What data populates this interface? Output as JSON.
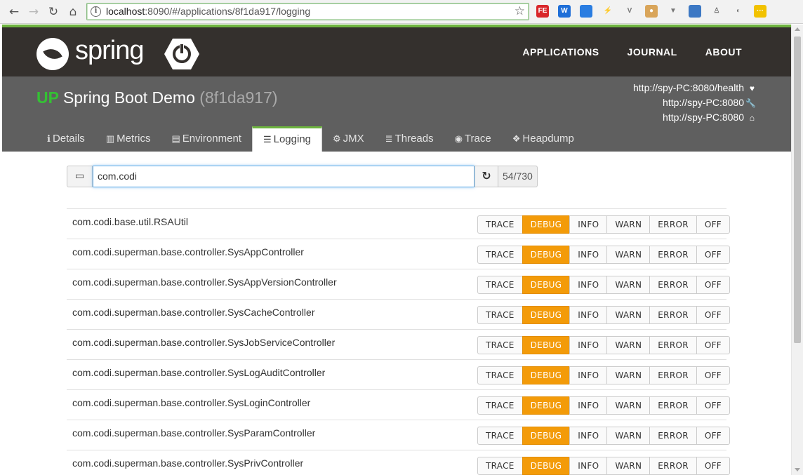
{
  "browser": {
    "url": "localhost:8090/#/applications/8f1da917/logging",
    "url_host": "localhost",
    "url_rest": ":8090/#/applications/8f1da917/logging",
    "extensions": [
      {
        "name": "fe-extension-icon",
        "label": "FE",
        "color": "#d9262a"
      },
      {
        "name": "w-extension-icon",
        "label": "W",
        "color": "#1f6fd8"
      },
      {
        "name": "blue-square-extension-icon",
        "label": "",
        "color": "#2a7de1"
      },
      {
        "name": "lightning-extension-icon",
        "label": "⚡",
        "color": "#ffffff"
      },
      {
        "name": "v-extension-icon",
        "label": "V",
        "color": "#ffffff"
      },
      {
        "name": "cookie-extension-icon",
        "label": "●",
        "color": "#d9a55a"
      },
      {
        "name": "vue-extension-icon",
        "label": "▼",
        "color": "#ffffff"
      },
      {
        "name": "window-extension-icon",
        "label": "",
        "color": "#3c78c4"
      },
      {
        "name": "puzzle-extension-icon",
        "label": "♙",
        "color": "#ffffff"
      },
      {
        "name": "circle-extension-icon",
        "label": "◐",
        "color": "#ffffff"
      },
      {
        "name": "menu-extension-icon",
        "label": "···",
        "color": "#f2c200"
      }
    ]
  },
  "topbar": {
    "logo_text": "spring",
    "nav": [
      "APPLICATIONS",
      "JOURNAL",
      "ABOUT"
    ]
  },
  "app": {
    "status": "UP",
    "name": "Spring Boot Demo",
    "id": "(8f1da917)",
    "links": [
      {
        "text": "http://spy-PC:8080/health",
        "icon": "heartbeat-icon",
        "glyph": "♥"
      },
      {
        "text": "http://spy-PC:8080",
        "icon": "wrench-icon",
        "glyph": "🔧"
      },
      {
        "text": "http://spy-PC:8080",
        "icon": "home-icon",
        "glyph": "⌂"
      }
    ],
    "tabs": [
      {
        "label": "Details",
        "icon": "info-icon",
        "glyph": "ℹ"
      },
      {
        "label": "Metrics",
        "icon": "bar-chart-icon",
        "glyph": "▥"
      },
      {
        "label": "Environment",
        "icon": "server-icon",
        "glyph": "▤"
      },
      {
        "label": "Logging",
        "icon": "sliders-icon",
        "glyph": "☰"
      },
      {
        "label": "JMX",
        "icon": "cogs-icon",
        "glyph": "⚙"
      },
      {
        "label": "Threads",
        "icon": "list-icon",
        "glyph": "≣"
      },
      {
        "label": "Trace",
        "icon": "eye-icon",
        "glyph": "◉"
      },
      {
        "label": "Heapdump",
        "icon": "cubes-icon",
        "glyph": "❖"
      }
    ],
    "active_tab": "Logging"
  },
  "filter": {
    "value": "com.codi",
    "count": "54/730"
  },
  "levels": [
    "TRACE",
    "DEBUG",
    "INFO",
    "WARN",
    "ERROR",
    "OFF"
  ],
  "loggers": [
    {
      "name": "com.codi.base.util.RSAUtil",
      "level": "DEBUG"
    },
    {
      "name": "com.codi.superman.base.controller.SysAppController",
      "level": "DEBUG"
    },
    {
      "name": "com.codi.superman.base.controller.SysAppVersionController",
      "level": "DEBUG"
    },
    {
      "name": "com.codi.superman.base.controller.SysCacheController",
      "level": "DEBUG"
    },
    {
      "name": "com.codi.superman.base.controller.SysJobServiceController",
      "level": "DEBUG"
    },
    {
      "name": "com.codi.superman.base.controller.SysLogAuditController",
      "level": "DEBUG"
    },
    {
      "name": "com.codi.superman.base.controller.SysLoginController",
      "level": "DEBUG"
    },
    {
      "name": "com.codi.superman.base.controller.SysParamController",
      "level": "DEBUG"
    },
    {
      "name": "com.codi.superman.base.controller.SysPrivController",
      "level": "DEBUG"
    }
  ],
  "colors": {
    "spring_green": "#6db33f",
    "status_up": "#34c134",
    "active_level": "#f39b09"
  }
}
